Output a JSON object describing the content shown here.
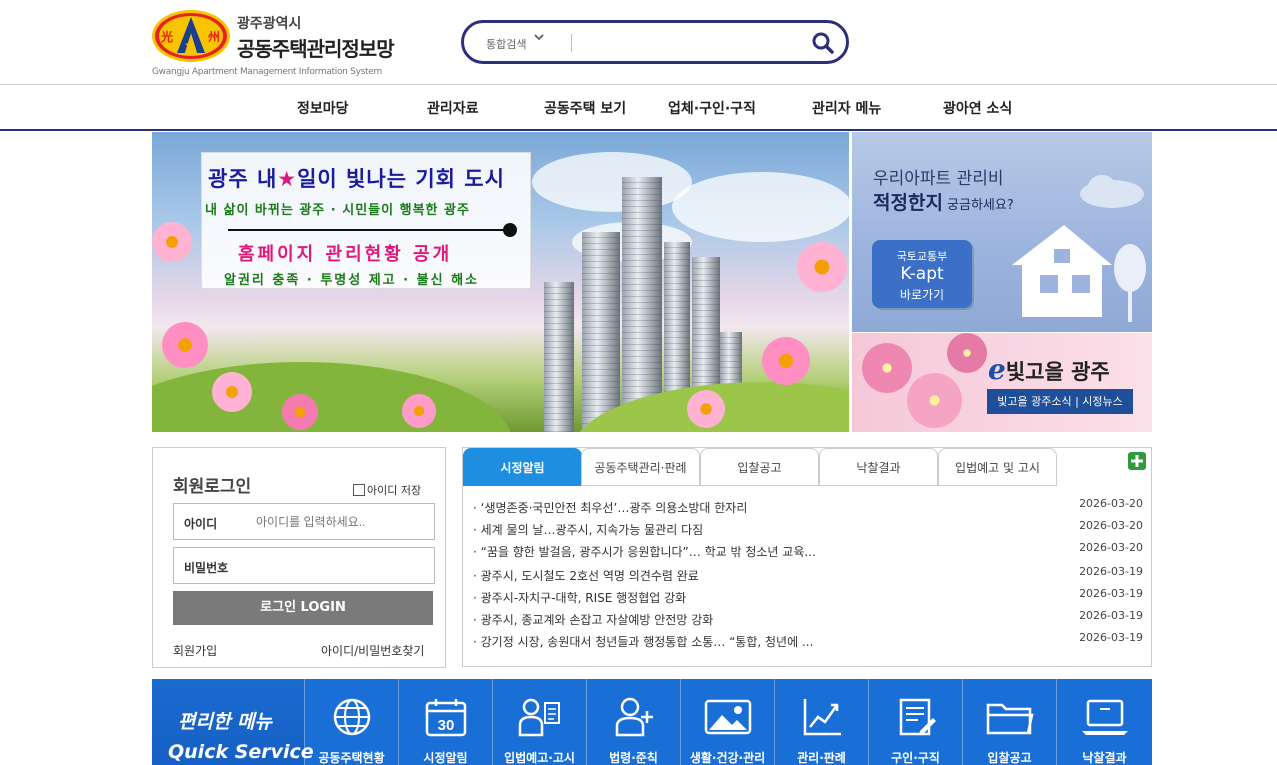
{
  "header": {
    "logo_left_char": "光",
    "logo_right_char": "州",
    "city": "광주광역시",
    "title": "공동주택관리정보망",
    "subtitle_en": "Gwangju Apartment Management Information System"
  },
  "search": {
    "scope": "통합검색",
    "placeholder": ""
  },
  "nav": [
    "정보마당",
    "관리자료",
    "공동주택 보기",
    "업체·구인·구직",
    "관리자 메뉴",
    "광아연 소식"
  ],
  "banner": {
    "line1_a": "광주 내",
    "line1_star": "★",
    "line1_b": "일이 빛나는 기회 도시",
    "line2": "내 삶이 바뀌는 광주 · 시민들이 행복한 광주",
    "line3": "홈페이지 관리현황 공개",
    "line4": "알권리 충족 · 투명성 제고 · 불신 해소"
  },
  "side_banner1": {
    "line1": "우리아파트 관리비",
    "line2": "적정한지",
    "line2_small": " 궁금하세요?",
    "btn_l1": "국토교통부",
    "btn_l2": "K-apt",
    "btn_l3": "바로가기"
  },
  "side_banner2": {
    "e": "e",
    "logo": "빛고을 광주",
    "btn": "빛고을 광주소식 | 시정뉴스"
  },
  "login": {
    "title": "회원로그인",
    "save_id": "아이디 저장",
    "id_label": "아이디",
    "id_placeholder": "아이디를 입력하세요..",
    "pw_label": "비밀번호",
    "login_btn": "로그인 LOGIN",
    "join": "회원가입",
    "find": "아이디/비밀번호찾기"
  },
  "news": {
    "tabs": [
      "시정알림",
      "공동주택관리·판례",
      "입찰공고",
      "낙찰결과",
      "입법예고 및 고시"
    ],
    "items": [
      {
        "title": "· ‘생명존중·국민안전 최우선’…광주 의용소방대 한자리",
        "date": "2026-03-20"
      },
      {
        "title": "· 세계 물의 날…광주시, 지속가능 물관리 다짐",
        "date": "2026-03-20"
      },
      {
        "title": "· “꿈을 향한 발걸음, 광주시가 응원합니다”… 학교 밖 청소년 교육...",
        "date": "2026-03-20"
      },
      {
        "title": "· 광주시, 도시철도 2호선 역명 의견수렴 완료",
        "date": "2026-03-19"
      },
      {
        "title": "· 광주시-자치구-대학, RISE 행정협업 강화",
        "date": "2026-03-19"
      },
      {
        "title": "· 광주시, 종교계와 손잡고 자살예방 안전망 강화",
        "date": "2026-03-19"
      },
      {
        "title": "· 강기정 시장, 송원대서 청년들과 행정통합 소통… “통합, 청년에 ...",
        "date": "2026-03-19"
      }
    ]
  },
  "quick": {
    "title1": "편리한 메뉴",
    "title2": "Quick Service",
    "items": [
      {
        "label": "공동주택현황",
        "icon": "globe-icon"
      },
      {
        "label": "시정알림",
        "icon": "calendar-icon",
        "num": "30"
      },
      {
        "label": "입법예고·고시",
        "icon": "person-document-icon"
      },
      {
        "label": "법령·준칙",
        "icon": "person-plus-icon"
      },
      {
        "label": "생활·건강·관리",
        "icon": "image-icon"
      },
      {
        "label": "관리·판례",
        "icon": "line-chart-icon"
      },
      {
        "label": "구인·구직",
        "icon": "document-edit-icon"
      },
      {
        "label": "입찰공고",
        "icon": "folder-icon"
      },
      {
        "label": "낙찰결과",
        "icon": "laptop-icon"
      }
    ]
  },
  "colors": {
    "brand_navy": "#2b2f7a",
    "tab_active": "#1e8fe0",
    "quick_bg": "#1a6fd6"
  }
}
